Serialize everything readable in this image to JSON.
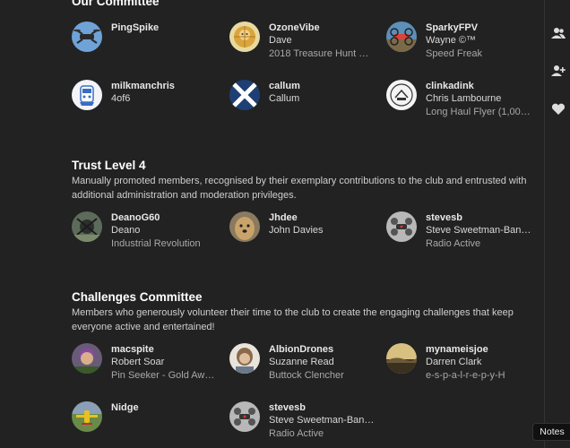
{
  "committee": {
    "title": "Our Committee",
    "members": [
      {
        "username": "PingSpike",
        "name": "",
        "title": ""
      },
      {
        "username": "OzoneVibe",
        "name": "Dave",
        "title": "2018 Treasure Hunt …"
      },
      {
        "username": "SparkyFPV",
        "name": "Wayne ©™",
        "title": "Speed Freak"
      },
      {
        "username": "milkmanchris",
        "name": "4of6",
        "title": ""
      },
      {
        "username": "callum",
        "name": "Callum",
        "title": ""
      },
      {
        "username": "clinkadink",
        "name": "Chris Lambourne",
        "title": "Long Haul Flyer (1,00…"
      }
    ]
  },
  "trust": {
    "title": "Trust Level 4",
    "description": "Manually promoted members, recognised by their exemplary contributions to the club and entrusted with additional administration and moderation privileges.",
    "members": [
      {
        "username": "DeanoG60",
        "name": "Deano",
        "title": "Industrial Revolution"
      },
      {
        "username": "Jhdee",
        "name": "John Davies",
        "title": ""
      },
      {
        "username": "stevesb",
        "name": "Steve Sweetman-Ban…",
        "title": "Radio Active"
      }
    ]
  },
  "challenges": {
    "title": "Challenges Committee",
    "description": "Members who generously volunteer their time to the club to create the engaging challenges that keep everyone active and entertained!",
    "members": [
      {
        "username": "macspite",
        "name": "Robert Soar",
        "title": "Pin Seeker - Gold Aw…"
      },
      {
        "username": "AlbionDrones",
        "name": "Suzanne Read",
        "title": "Buttock Clencher"
      },
      {
        "username": "mynameisjoe",
        "name": "Darren Clark",
        "title": "e-s-p-a-l-r-e-p-y-H"
      },
      {
        "username": "Nidge",
        "name": "",
        "title": ""
      },
      {
        "username": "stevesb",
        "name": "Steve Sweetman-Ban…",
        "title": "Radio Active"
      }
    ]
  },
  "sidebar": {
    "icons": [
      "users-icon",
      "user-plus-icon",
      "heart-icon"
    ]
  },
  "notes": {
    "label": "Notes"
  }
}
